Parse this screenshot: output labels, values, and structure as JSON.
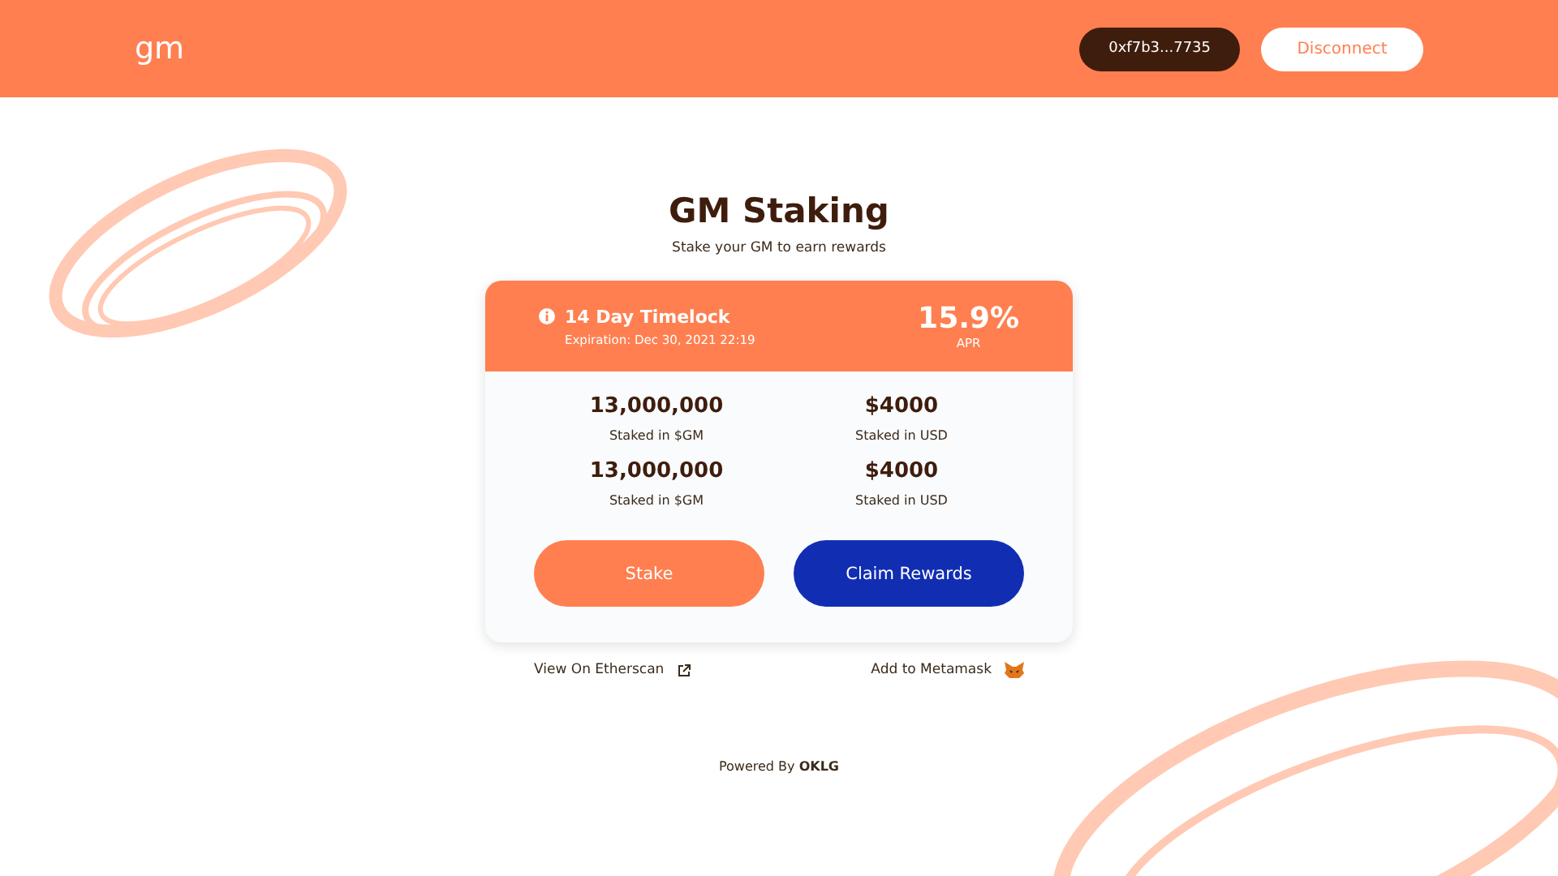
{
  "header": {
    "logo": "gm",
    "address": "0xf7b3...7735",
    "disconnect": "Disconnect"
  },
  "title": "GM Staking",
  "subtitle": "Stake your GM to earn rewards",
  "pool": {
    "name": "14 Day Timelock",
    "expiration": "Expiration: Dec 30, 2021 22:19",
    "apr": "15.9%",
    "apr_label": "APR",
    "stats": [
      {
        "value": "13,000,000",
        "label": "Staked in $GM"
      },
      {
        "value": "$4000",
        "label": "Staked in USD"
      },
      {
        "value": "13,000,000",
        "label": "Staked in $GM"
      },
      {
        "value": "$4000",
        "label": "Staked in USD"
      }
    ],
    "buttons": [
      {
        "label": "Stake",
        "kind": "primary"
      },
      {
        "label": "Claim Rewards",
        "kind": "secondary"
      }
    ]
  },
  "links": [
    {
      "label": "View On Etherscan",
      "kind": "external"
    },
    {
      "label": "Add to Metamask",
      "kind": "fox"
    }
  ],
  "footer": "Powered By **OKLG**"
}
